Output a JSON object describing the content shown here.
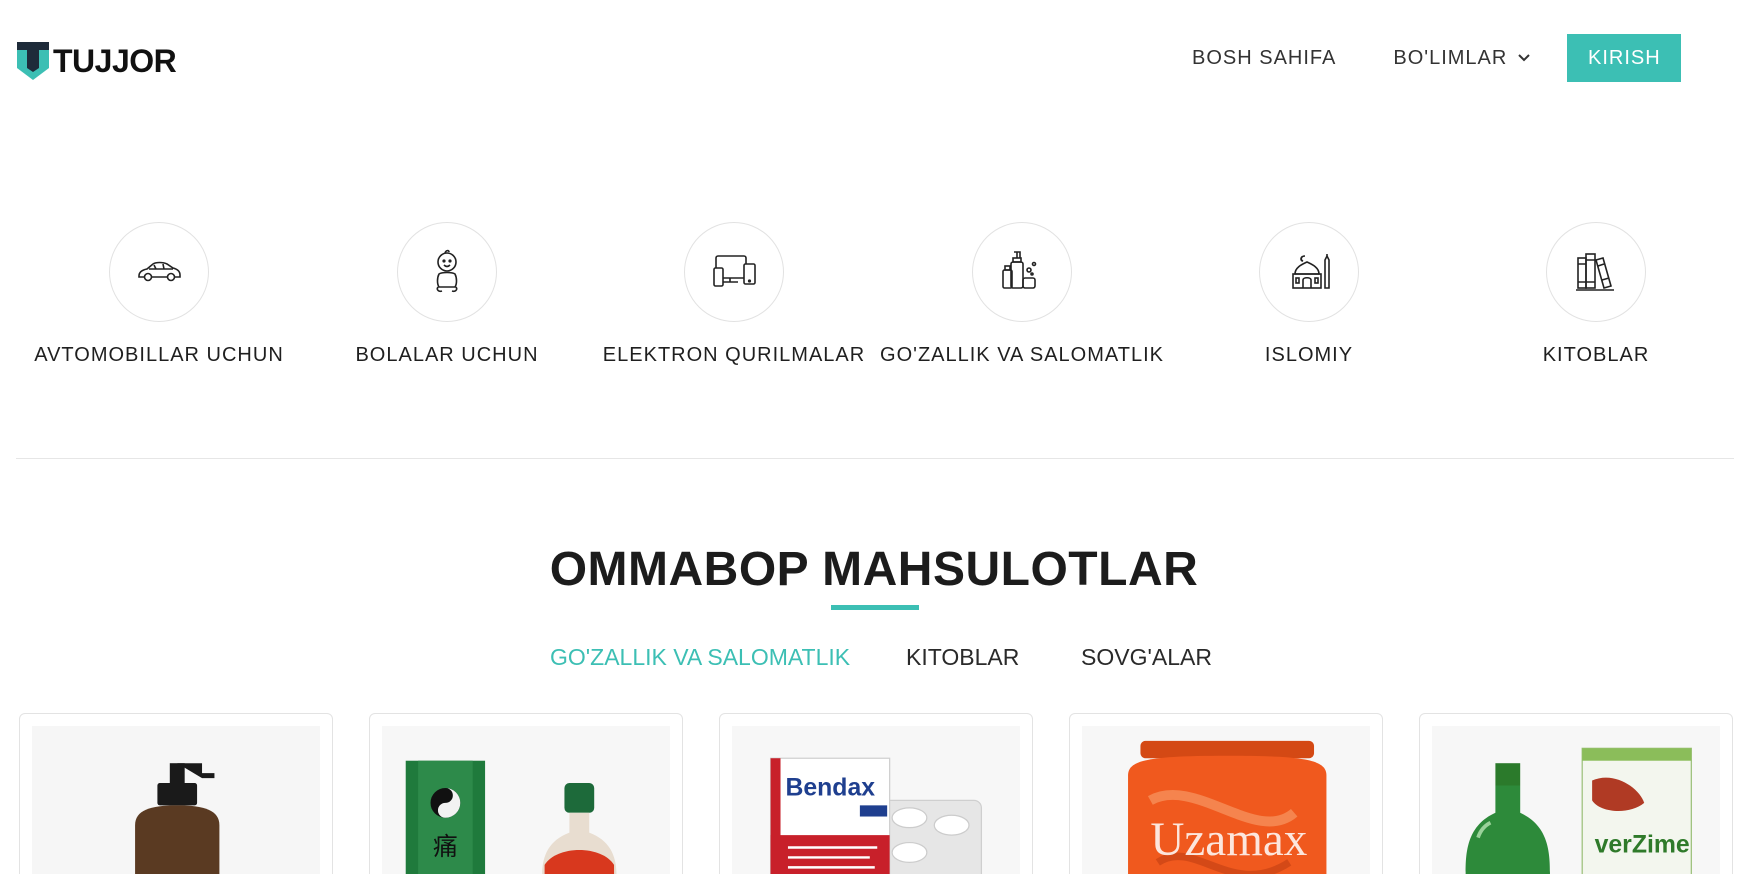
{
  "header": {
    "logo_text": "TUJJOR",
    "logo_icon": "tujjor-shield-logo",
    "nav": {
      "home": "BOSH SAHIFA",
      "sections": "BO'LIMLAR",
      "sections_icon": "chevron-down-icon",
      "login": "KIRISH"
    }
  },
  "categories": [
    {
      "label": "AVTOMOBILLAR UCHUN",
      "icon": "car-icon"
    },
    {
      "label": "BOLALAR UCHUN",
      "icon": "baby-icon"
    },
    {
      "label": "ELEKTRON QURILMALAR",
      "icon": "devices-icon"
    },
    {
      "label": "GO'ZALLIK VA SALOMATLIK",
      "icon": "cosmetics-icon"
    },
    {
      "label": "ISLOMIY",
      "icon": "mosque-icon"
    },
    {
      "label": "KITOBLAR",
      "icon": "books-icon"
    }
  ],
  "popular": {
    "title": "OMMABOP MAHSULOTLAR",
    "tabs": [
      {
        "label": "GO'ZALLIK VA SALOMATLIK",
        "active": true
      },
      {
        "label": "KITOBLAR",
        "active": false
      },
      {
        "label": "SOVG'ALAR",
        "active": false
      }
    ],
    "products": [
      {
        "image": "pump-bottle-product-image",
        "image_text": ""
      },
      {
        "image": "chinese-oil-bottle-product-image",
        "image_text": ""
      },
      {
        "image": "bendax-tablets-product-image",
        "image_text": "Bendax"
      },
      {
        "image": "uzamax-jar-product-image",
        "image_text": "Uzamax"
      },
      {
        "image": "liverzime-tonic-product-image",
        "image_text": "verZime"
      }
    ]
  },
  "colors": {
    "accent": "#3cbfb4",
    "text": "#222222",
    "border": "#e3e3e3"
  }
}
